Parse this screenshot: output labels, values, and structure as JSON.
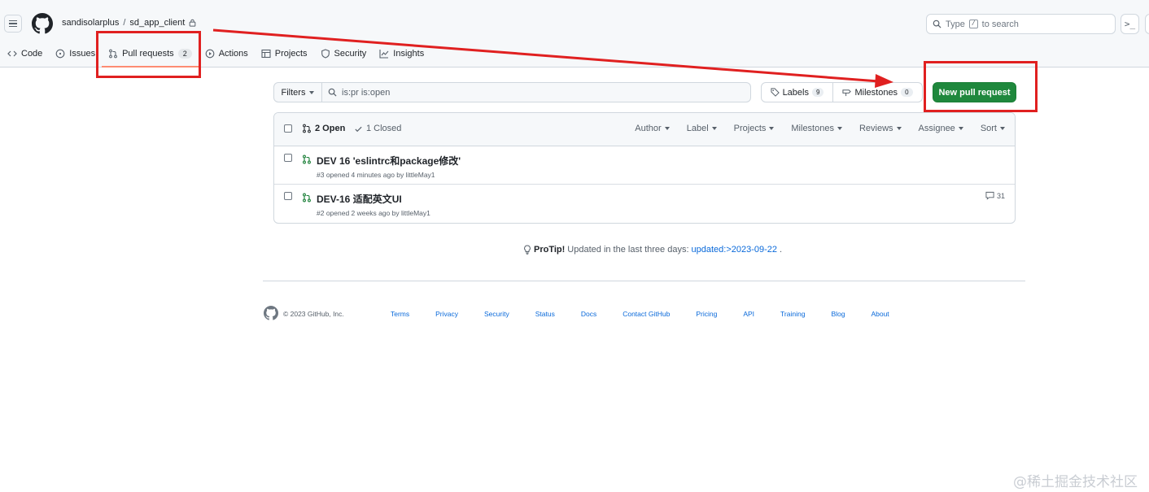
{
  "header": {
    "owner": "sandisolarplus",
    "separator": "/",
    "repo": "sd_app_client",
    "search": {
      "prefix": "Type",
      "key": "/",
      "suffix": "to search"
    },
    "command_glyph": ">_"
  },
  "tabs": [
    {
      "label": "Code",
      "icon": "code-icon"
    },
    {
      "label": "Issues",
      "icon": "issue-icon"
    },
    {
      "label": "Pull requests",
      "icon": "pull-request-icon",
      "count": "2",
      "selected": true
    },
    {
      "label": "Actions",
      "icon": "play-icon"
    },
    {
      "label": "Projects",
      "icon": "table-icon"
    },
    {
      "label": "Security",
      "icon": "shield-icon"
    },
    {
      "label": "Insights",
      "icon": "graph-icon"
    }
  ],
  "subnav": {
    "filters_label": "Filters",
    "query": "is:pr is:open",
    "labels_label": "Labels",
    "labels_count": "9",
    "milestones_label": "Milestones",
    "milestones_count": "0",
    "new_pr_label": "New pull request"
  },
  "list": {
    "open_label": "2 Open",
    "closed_label": "1 Closed",
    "sort_options": [
      "Author",
      "Label",
      "Projects",
      "Milestones",
      "Reviews",
      "Assignee",
      "Sort"
    ],
    "rows": [
      {
        "title": "DEV 16 'eslintrc和package修改'",
        "meta": "#3 opened 4 minutes ago by littleMay1",
        "comments": ""
      },
      {
        "title": "DEV-16 适配英文UI",
        "meta": "#2 opened 2 weeks ago by littleMay1",
        "comments": "31"
      }
    ]
  },
  "protip": {
    "bold": "ProTip!",
    "text": "Updated in the last three days:",
    "link": "updated:>2023-09-22",
    "end": "."
  },
  "footer": {
    "copyright": "© 2023 GitHub, Inc.",
    "links": [
      "Terms",
      "Privacy",
      "Security",
      "Status",
      "Docs",
      "Contact GitHub",
      "Pricing",
      "API",
      "Training",
      "Blog",
      "About"
    ]
  },
  "watermark": "@稀土掘金技术社区",
  "colors": {
    "accent_green": "#1f883d",
    "annotation_red": "#e02020",
    "link_blue": "#0969da"
  }
}
